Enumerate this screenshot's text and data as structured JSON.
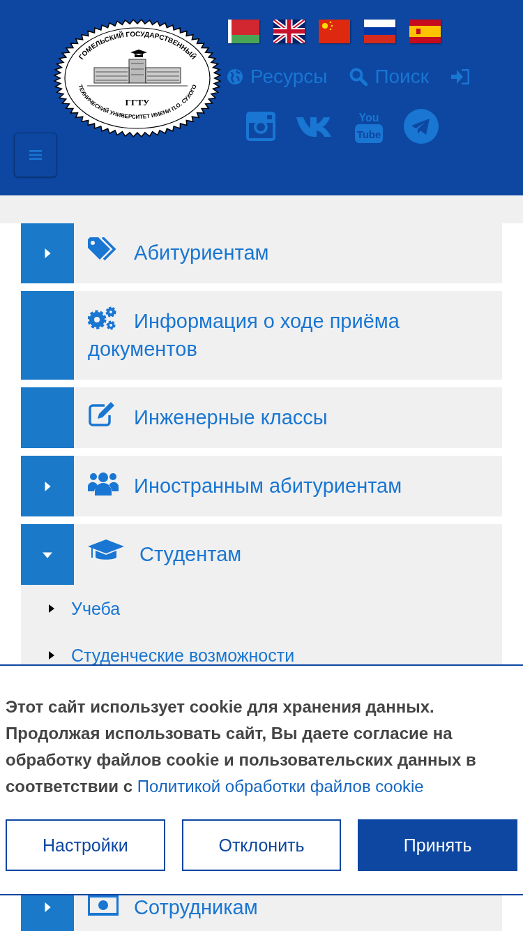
{
  "logo": {
    "top_text": "ГОМЕЛЬСКИЙ ГОСУДАРСТВЕННЫЙ",
    "bottom_text": "ТЕХНИЧЕСКИЙ УНИВЕРСИТЕТ ИМЕНИ П.О. СУХОГО",
    "abbr": "ГГТУ"
  },
  "languages": [
    {
      "kind": "by"
    },
    {
      "kind": "gb"
    },
    {
      "kind": "cn"
    },
    {
      "kind": "ru"
    },
    {
      "kind": "es"
    }
  ],
  "top_links": [
    {
      "kind": "globe",
      "label": "Ресурсы"
    },
    {
      "kind": "search",
      "label": "Поиск"
    },
    {
      "kind": "login"
    }
  ],
  "social": [
    {
      "kind": "instagram"
    },
    {
      "kind": "vk"
    },
    {
      "kind": "youtube",
      "label_top": "You",
      "label_bottom": "Tube"
    },
    {
      "kind": "telegram"
    }
  ],
  "menu": [
    {
      "kind": "group",
      "label": "Абитуриентам",
      "expanded": false
    },
    {
      "kind": "link",
      "label": "Информация о ходе приёма документов"
    },
    {
      "kind": "link",
      "label": "Инженерные классы"
    },
    {
      "kind": "group",
      "label": "Иностранным абитуриентам",
      "expanded": false
    },
    {
      "kind": "group",
      "label": "Студентам",
      "expanded": true,
      "children": [
        {
          "label": "Учеба"
        },
        {
          "label": "Студенческие возможности"
        }
      ]
    },
    {
      "kind": "group",
      "label": "Сотрудникам",
      "expanded": false
    }
  ],
  "cookie_banner": {
    "text": "Этот сайт использует cookie для хранения данных. Продолжая использовать сайт, Вы даете согласие на обработку файлов cookie и пользовательских данных в соответствии с",
    "link": "Политикой обработки файлов cookie",
    "buttons": [
      {
        "kind": "outline",
        "label": "Настройки"
      },
      {
        "kind": "outline",
        "label": "Отклонить"
      },
      {
        "kind": "primary",
        "label": "Принять"
      }
    ]
  }
}
